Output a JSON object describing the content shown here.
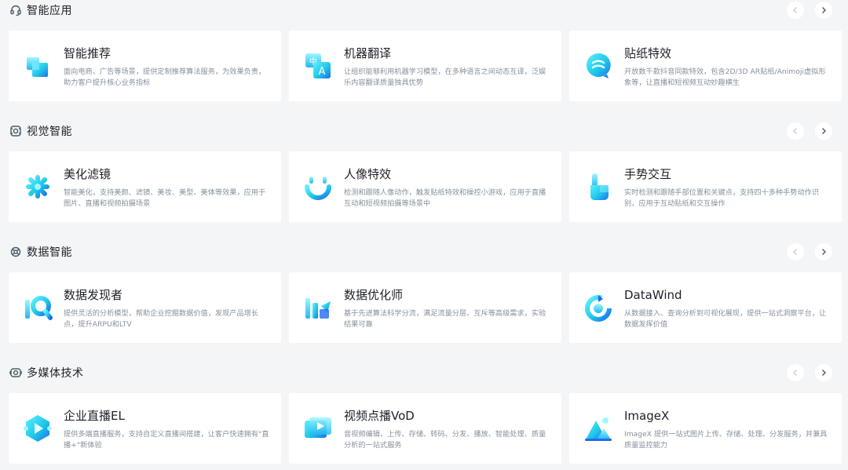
{
  "accent": "#1ec8e8",
  "sections": [
    {
      "title": "智能应用",
      "icon": "headset-icon",
      "cards": [
        {
          "title": "智能推荐",
          "icon": "cube-stack-icon",
          "desc": "面向电商、广告等场景，提供定制推荐算法服务，为效果负责，助力客户提升核心业务指标"
        },
        {
          "title": "机器翻译",
          "icon": "translate-icon",
          "desc": "让组织能够利用机器学习模型，在多种语言之间动态互译，泛娱乐内容翻译质量独具优势"
        },
        {
          "title": "贴纸特效",
          "icon": "sticker-icon",
          "desc": "开放数千款抖音同款特效，包含2D/3D AR贴纸/Animoji虚拟形象等，让直播和短视频互动妙趣横生"
        }
      ]
    },
    {
      "title": "视觉智能",
      "icon": "vision-icon",
      "cards": [
        {
          "title": "美化滤镜",
          "icon": "sparkle-icon",
          "desc": "智能美化，支持美颜、滤镜、美妆、美型、美体等效果，应用于图片、直播和视频拍摄场景"
        },
        {
          "title": "人像特效",
          "icon": "smile-face-icon",
          "desc": "检测和跟随人像动作，触发贴纸特效和操控小游戏，应用于直播互动和短视频拍摄等场景中"
        },
        {
          "title": "手势交互",
          "icon": "hand-point-icon",
          "desc": "实时检测和跟随手部位置和关键点，支持四十多种手势动作识别，应用于互动贴纸和交互操作"
        }
      ]
    },
    {
      "title": "数据智能",
      "icon": "data-ring-icon",
      "cards": [
        {
          "title": "数据发现者",
          "icon": "data-search-icon",
          "desc": "提供灵活的分析模型，帮助企业挖掘数据价值，发现产品增长点，提升ARPU和LTV"
        },
        {
          "title": "数据优化师",
          "icon": "optimize-shapes-icon",
          "desc": "基于先进算法科学分流，满足流量分层、互斥等高级需求，实验结果可靠"
        },
        {
          "title": "DataWind",
          "icon": "datawind-ring-icon",
          "desc": "从数据接入、查询分析到可视化展现，提供一站式洞察平台，让数据发挥价值"
        }
      ]
    },
    {
      "title": "多媒体技术",
      "icon": "media-icon",
      "cards": [
        {
          "title": "企业直播EL",
          "icon": "live-play-icon",
          "desc": "提供多端直播服务，支持自定义直播间搭建，让客户快速拥有\"直播+\"新体验"
        },
        {
          "title": "视频点播VoD",
          "icon": "video-play-icon",
          "desc": "音视频编辑、上传、存储、转码、分发、播放、智能处理、质量分析的一站式服务"
        },
        {
          "title": "ImageX",
          "icon": "image-mountain-icon",
          "desc": "ImageX 提供一站式图片上传、存储、处理、分发服务，并兼具质量监控能力"
        }
      ]
    }
  ]
}
